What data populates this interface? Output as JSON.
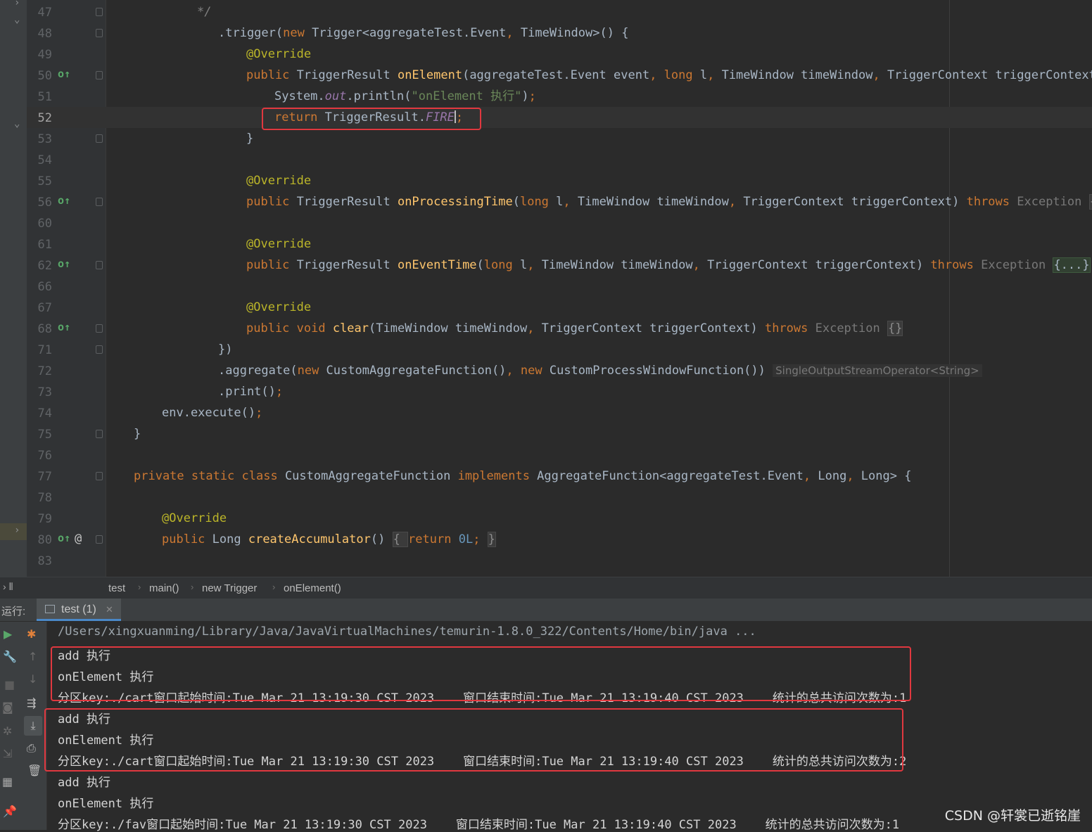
{
  "editor": {
    "lines": [
      {
        "n": "47",
        "code": [
          [
            "c",
            "*/"
          ]
        ],
        "indent": 130
      },
      {
        "n": "48",
        "code": [
          [
            "",
            ".trigger("
          ],
          [
            "k",
            "new "
          ],
          [
            "",
            "Trigger<aggregateTest.Event"
          ],
          [
            "k",
            ", "
          ],
          [
            "",
            "TimeWindow>() {"
          ]
        ],
        "indent": 160
      },
      {
        "n": "49",
        "code": [
          [
            "a",
            "@Override"
          ]
        ],
        "indent": 200
      },
      {
        "n": "50",
        "code": [
          [
            "k",
            "public "
          ],
          [
            "",
            "TriggerResult "
          ],
          [
            "f",
            "onElement"
          ],
          [
            "",
            "(aggregateTest.Event event"
          ],
          [
            "k",
            ", long "
          ],
          [
            "",
            "l"
          ],
          [
            "k",
            ", "
          ],
          [
            "",
            "TimeWindow timeWindow"
          ],
          [
            "k",
            ", "
          ],
          [
            "",
            "TriggerContext triggerContext) "
          ],
          [
            "k",
            "t"
          ]
        ],
        "indent": 200
      },
      {
        "n": "51",
        "code": [
          [
            "",
            "System."
          ],
          [
            "st",
            "out"
          ],
          [
            "",
            ".println("
          ],
          [
            "s",
            "\"onElement 执行\""
          ],
          [
            "",
            ")"
          ],
          [
            "k",
            ";"
          ]
        ],
        "indent": 240
      },
      {
        "n": "52",
        "code": [
          [
            "k",
            "return "
          ],
          [
            "",
            "TriggerResult."
          ],
          [
            "st",
            "FIRE"
          ],
          [
            "caret",
            ""
          ],
          [
            "k",
            ";"
          ]
        ],
        "indent": 240
      },
      {
        "n": "53",
        "code": [
          [
            "",
            "}"
          ]
        ],
        "indent": 200
      },
      {
        "n": "54",
        "code": [],
        "indent": 0
      },
      {
        "n": "55",
        "code": [
          [
            "a",
            "@Override"
          ]
        ],
        "indent": 200
      },
      {
        "n": "56",
        "code": [
          [
            "k",
            "public "
          ],
          [
            "",
            "TriggerResult "
          ],
          [
            "f",
            "onProcessingTime"
          ],
          [
            "",
            "("
          ],
          [
            "k",
            "long "
          ],
          [
            "",
            "l"
          ],
          [
            "k",
            ", "
          ],
          [
            "",
            "TimeWindow timeWindow"
          ],
          [
            "k",
            ", "
          ],
          [
            "",
            "TriggerContext triggerContext) "
          ],
          [
            "k",
            "throws "
          ],
          [
            "exc",
            "Exception "
          ],
          [
            "fbox",
            "{..."
          ]
        ],
        "indent": 200
      },
      {
        "n": "60",
        "code": [],
        "indent": 0
      },
      {
        "n": "61",
        "code": [
          [
            "a",
            "@Override"
          ]
        ],
        "indent": 200
      },
      {
        "n": "62",
        "code": [
          [
            "k",
            "public "
          ],
          [
            "",
            "TriggerResult "
          ],
          [
            "f",
            "onEventTime"
          ],
          [
            "",
            "("
          ],
          [
            "k",
            "long "
          ],
          [
            "",
            "l"
          ],
          [
            "k",
            ", "
          ],
          [
            "",
            "TimeWindow timeWindow"
          ],
          [
            "k",
            ", "
          ],
          [
            "",
            "TriggerContext triggerContext) "
          ],
          [
            "k",
            "throws "
          ],
          [
            "exc",
            "Exception "
          ],
          [
            "fbox2",
            "{...}"
          ]
        ],
        "indent": 200
      },
      {
        "n": "66",
        "code": [],
        "indent": 0
      },
      {
        "n": "67",
        "code": [
          [
            "a",
            "@Override"
          ]
        ],
        "indent": 200
      },
      {
        "n": "68",
        "code": [
          [
            "k",
            "public void "
          ],
          [
            "f",
            "clear"
          ],
          [
            "",
            "(TimeWindow timeWindow"
          ],
          [
            "k",
            ", "
          ],
          [
            "",
            "TriggerContext triggerContext) "
          ],
          [
            "k",
            "throws "
          ],
          [
            "exc",
            "Exception "
          ],
          [
            "fbox",
            "{}"
          ]
        ],
        "indent": 200
      },
      {
        "n": "71",
        "code": [
          [
            "",
            "})"
          ]
        ],
        "indent": 160
      },
      {
        "n": "72",
        "code": [
          [
            "",
            ".aggregate("
          ],
          [
            "k",
            "new "
          ],
          [
            "",
            "CustomAggregateFunction()"
          ],
          [
            "k",
            ", new "
          ],
          [
            "",
            "CustomProcessWindowFunction()) "
          ],
          [
            "hint",
            "SingleOutputStreamOperator<String>"
          ]
        ],
        "indent": 160
      },
      {
        "n": "73",
        "code": [
          [
            "",
            ".print()"
          ],
          [
            "k",
            ";"
          ]
        ],
        "indent": 160
      },
      {
        "n": "74",
        "code": [
          [
            "",
            "env.execute()"
          ],
          [
            "k",
            ";"
          ]
        ],
        "indent": 80
      },
      {
        "n": "75",
        "code": [
          [
            "",
            "}"
          ]
        ],
        "indent": 40
      },
      {
        "n": "76",
        "code": [],
        "indent": 0
      },
      {
        "n": "77",
        "code": [
          [
            "k",
            "private static class "
          ],
          [
            "",
            "CustomAggregateFunction "
          ],
          [
            "k",
            "implements "
          ],
          [
            "",
            "AggregateFunction<aggregateTest.Event"
          ],
          [
            "k",
            ", "
          ],
          [
            "",
            "Long"
          ],
          [
            "k",
            ", "
          ],
          [
            "",
            "Long> {"
          ]
        ],
        "indent": 40
      },
      {
        "n": "78",
        "code": [],
        "indent": 0
      },
      {
        "n": "79",
        "code": [
          [
            "a",
            "@Override"
          ]
        ],
        "indent": 80
      },
      {
        "n": "80",
        "code": [
          [
            "k",
            "public "
          ],
          [
            "",
            "Long "
          ],
          [
            "f",
            "createAccumulator"
          ],
          [
            "",
            "() "
          ],
          [
            "fbox",
            "{ "
          ],
          [
            "k",
            "return "
          ],
          [
            "st2",
            "0L"
          ],
          [
            "k",
            "; "
          ],
          [
            "fbox",
            "}"
          ]
        ],
        "indent": 80
      },
      {
        "n": "83",
        "code": [],
        "indent": 0
      }
    ],
    "gutter_override_lines": [
      "50",
      "56",
      "62",
      "68",
      "80"
    ],
    "current_line": "52"
  },
  "breadcrumb": {
    "items": [
      "test",
      "main()",
      "new Trigger",
      "onElement()"
    ]
  },
  "run": {
    "label": "运行:",
    "tab_label": "test (1)"
  },
  "console": {
    "lines": [
      "/Users/xingxuanming/Library/Java/JavaVirtualMachines/temurin-1.8.0_322/Contents/Home/bin/java ...",
      "add 执行",
      "onElement 执行",
      "分区key:./cart窗口起始时间:Tue Mar 21 13:19:30 CST 2023    窗口结束时间:Tue Mar 21 13:19:40 CST 2023    统计的总共访问次数为:1",
      "add 执行",
      "onElement 执行",
      "分区key:./cart窗口起始时间:Tue Mar 21 13:19:30 CST 2023    窗口结束时间:Tue Mar 21 13:19:40 CST 2023    统计的总共访问次数为:2",
      "add 执行",
      "onElement 执行",
      "分区key:./fav窗口起始时间:Tue Mar 21 13:19:30 CST 2023    窗口结束时间:Tue Mar 21 13:19:40 CST 2023    统计的总共访问次数为:1"
    ]
  },
  "watermark": "CSDN @轩裳已逝铭崖",
  "colors": {
    "keyword": "#cc7832",
    "annotation": "#bbb529",
    "method": "#ffc66d",
    "string": "#6a8759",
    "highlight_box": "#e0383f"
  }
}
